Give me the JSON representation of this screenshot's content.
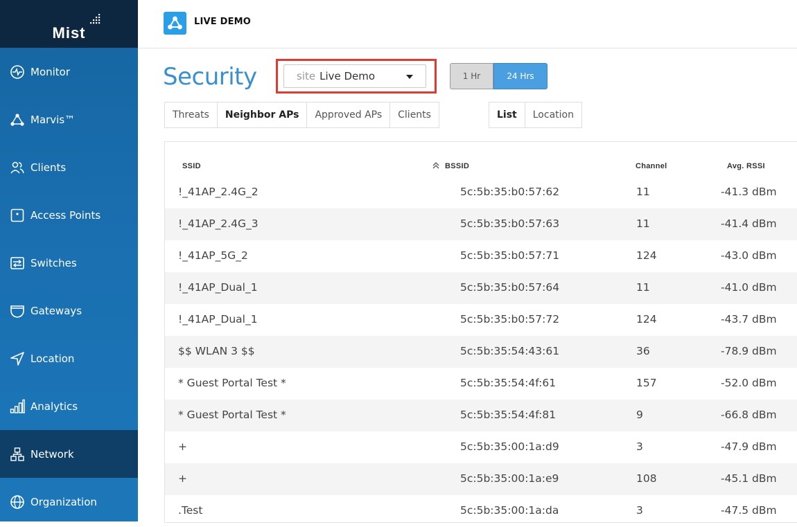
{
  "brand": {
    "logo": "Mist"
  },
  "org": {
    "name": "LIVE DEMO"
  },
  "sidebar": {
    "items": [
      {
        "label": "Monitor",
        "icon": "monitor-icon"
      },
      {
        "label": "Marvis™",
        "icon": "marvis-icon"
      },
      {
        "label": "Clients",
        "icon": "clients-icon"
      },
      {
        "label": "Access Points",
        "icon": "access-point-icon"
      },
      {
        "label": "Switches",
        "icon": "switch-icon"
      },
      {
        "label": "Gateways",
        "icon": "gateway-icon"
      },
      {
        "label": "Location",
        "icon": "location-icon"
      },
      {
        "label": "Analytics",
        "icon": "analytics-icon"
      },
      {
        "label": "Network",
        "icon": "network-icon",
        "active": true
      },
      {
        "label": "Organization",
        "icon": "organization-icon"
      }
    ]
  },
  "page": {
    "title": "Security"
  },
  "site": {
    "prefix": "site",
    "value": "Live Demo"
  },
  "time_range": {
    "options": [
      "1 Hr",
      "24 Hrs"
    ],
    "selected": "24 Hrs"
  },
  "tabs": [
    "Threats",
    "Neighbor APs",
    "Approved APs",
    "Clients"
  ],
  "active_tab": "Neighbor APs",
  "view_tabs": [
    "List",
    "Location"
  ],
  "active_view": "List",
  "table": {
    "columns": [
      "SSID",
      "BSSID",
      "Channel",
      "Avg. RSSI"
    ],
    "sorted_by": "SSID",
    "rows": [
      [
        "!_41AP_2.4G_2",
        "5c:5b:35:b0:57:62",
        "11",
        "-41.3 dBm"
      ],
      [
        "!_41AP_2.4G_3",
        "5c:5b:35:b0:57:63",
        "11",
        "-41.4 dBm"
      ],
      [
        "!_41AP_5G_2",
        "5c:5b:35:b0:57:71",
        "124",
        "-43.0 dBm"
      ],
      [
        "!_41AP_Dual_1",
        "5c:5b:35:b0:57:64",
        "11",
        "-41.0 dBm"
      ],
      [
        "!_41AP_Dual_1",
        "5c:5b:35:b0:57:72",
        "124",
        "-43.7 dBm"
      ],
      [
        "$$ WLAN 3 $$",
        "5c:5b:35:54:43:61",
        "36",
        "-78.9 dBm"
      ],
      [
        "* Guest Portal Test *",
        "5c:5b:35:54:4f:61",
        "157",
        "-52.0 dBm"
      ],
      [
        "* Guest Portal Test *",
        "5c:5b:35:54:4f:81",
        "9",
        "-66.8 dBm"
      ],
      [
        "+",
        "5c:5b:35:00:1a:d9",
        "3",
        "-47.9 dBm"
      ],
      [
        "+",
        "5c:5b:35:00:1a:e9",
        "108",
        "-45.1 dBm"
      ],
      [
        ".Test",
        "5c:5b:35:00:1a:da",
        "3",
        "-47.5 dBm"
      ]
    ]
  },
  "colors": {
    "sidebar": "#1a6fb0",
    "sidebar_active": "#0f3f66",
    "logo_bg": "#0e2741",
    "accent": "#3a8fcf",
    "selected_button": "#4a9fe0",
    "highlight_box": "#e03b32"
  }
}
